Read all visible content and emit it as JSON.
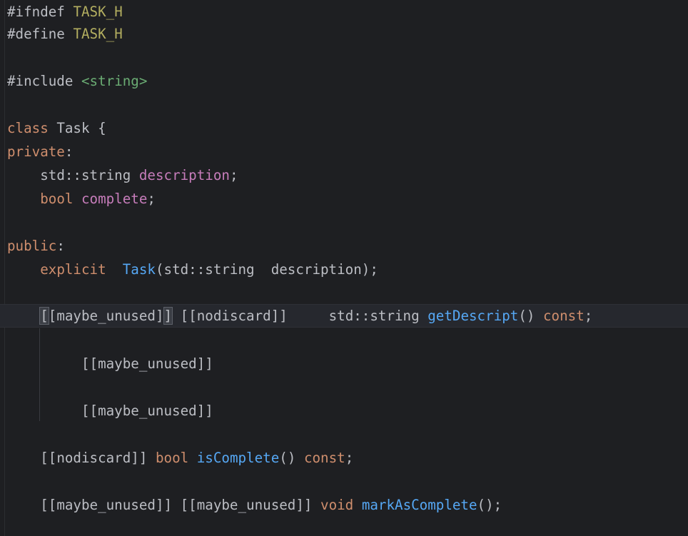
{
  "editor": {
    "lines": {
      "l1": {
        "directive": "#ifndef",
        "macro": "TASK_H"
      },
      "l2": {
        "directive": "#define",
        "macro": "TASK_H"
      },
      "l3": {
        "directive": "#include",
        "header": "<string>"
      },
      "l4": {
        "keyword": "class",
        "name": "Task",
        "brace": "{"
      },
      "l5": {
        "access": "private",
        "colon": ":"
      },
      "l6": {
        "type": "std::string",
        "field": "description",
        "semi": ";"
      },
      "l7": {
        "type": "bool",
        "field": "complete",
        "semi": ";"
      },
      "l8": {
        "access": "public",
        "colon": ":"
      },
      "l9": {
        "keyword": "explicit",
        "fn": "Task",
        "params": "(std::string  description);"
      },
      "l10": {
        "attr1_open": "[",
        "attr1_mid": "[maybe_unused]",
        "attr1_close": "]",
        "attr2": "[[nodiscard]]",
        "type": "std::string",
        "fn": "getDescript",
        "parens": "()",
        "qual": "const",
        "semi": ";"
      },
      "l11": {
        "attr": "[[maybe_unused]]"
      },
      "l12": {
        "attr": "[[maybe_unused]]"
      },
      "l13": {
        "attr": "[[nodiscard]]",
        "type": "bool",
        "fn": "isComplete",
        "parens": "()",
        "qual": "const",
        "semi": ";"
      },
      "l14": {
        "attr1": "[[maybe_unused]]",
        "attr2": "[[maybe_unused]]",
        "type": "void",
        "fn": "markAsComplete",
        "tail": "();"
      }
    }
  }
}
